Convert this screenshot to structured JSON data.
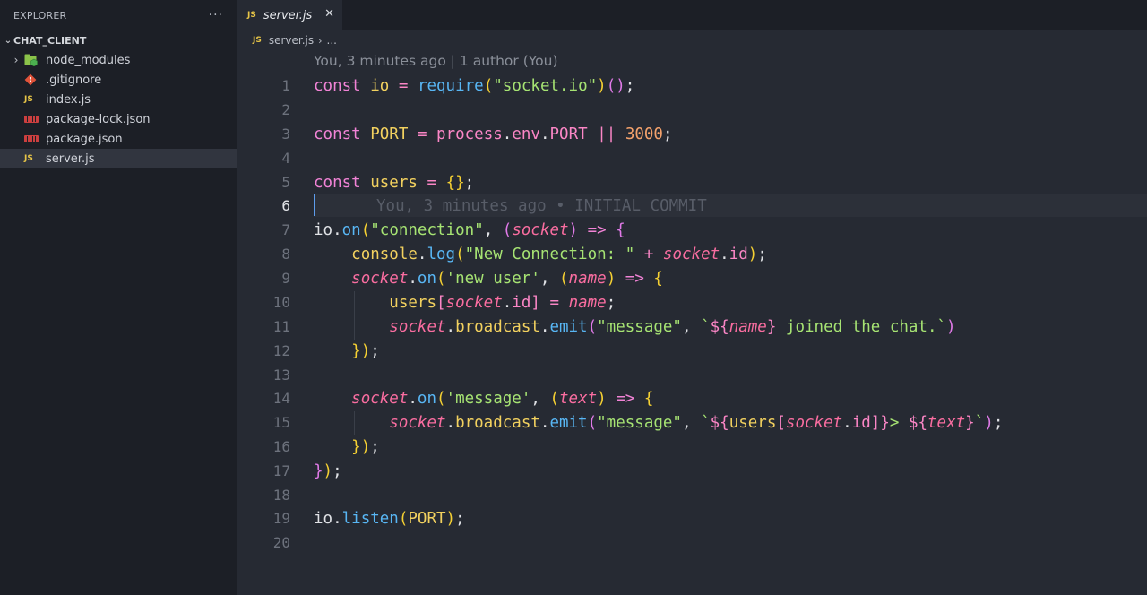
{
  "explorer": {
    "title": "EXPLORER",
    "more": "···",
    "folder": "CHAT_CLIENT",
    "items": [
      {
        "label": "node_modules",
        "icon": "node-folder-icon",
        "expandable": true
      },
      {
        "label": ".gitignore",
        "icon": "git-icon"
      },
      {
        "label": "index.js",
        "icon": "js-file-icon"
      },
      {
        "label": "package-lock.json",
        "icon": "json-file-icon"
      },
      {
        "label": "package.json",
        "icon": "json-file-icon"
      },
      {
        "label": "server.js",
        "icon": "js-file-icon",
        "selected": true
      }
    ]
  },
  "tab": {
    "badge": "JS",
    "label": "server.js",
    "close": "✕"
  },
  "breadcrumb": {
    "badge": "JS",
    "file": "server.js",
    "sep": "›",
    "more": "..."
  },
  "editor": {
    "codelens": "You, 3 minutes ago | 1 author (You)",
    "blame": "You, 3 minutes ago • INITIAL COMMIT",
    "active_line": 6,
    "line_numbers": [
      "1",
      "2",
      "3",
      "4",
      "5",
      "6",
      "7",
      "8",
      "9",
      "10",
      "11",
      "12",
      "13",
      "14",
      "15",
      "16",
      "17",
      "18",
      "19",
      "20"
    ]
  },
  "theme": {
    "background": "#262a33",
    "sidebar": "#1c1f26",
    "keyword": "#f183d6",
    "string": "#a6e373",
    "function": "#58b6f4"
  }
}
